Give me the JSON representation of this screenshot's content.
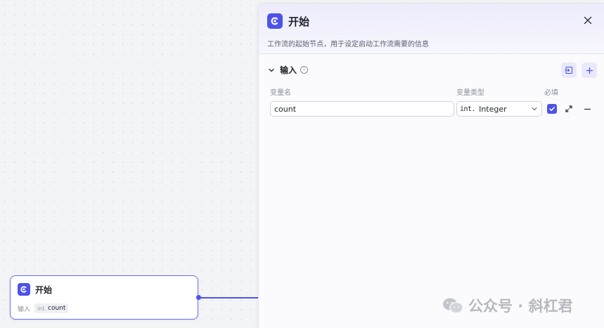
{
  "canvas": {
    "node": {
      "title": "开始",
      "input_label": "输入",
      "param_type": "int.",
      "param_name": "count"
    }
  },
  "panel": {
    "title": "开始",
    "description": "工作流的起始节点，用于设定启动工作流需要的信息",
    "section": {
      "title": "输入",
      "columns": {
        "name": "变量名",
        "type": "变量类型",
        "required": "必填"
      },
      "variables": [
        {
          "name": "count",
          "type_prefix": "int.",
          "type": "Integer",
          "required": true
        }
      ]
    }
  },
  "watermark": {
    "text": "公众号 · 斜杠君"
  },
  "colors": {
    "accent": "#4d53e8",
    "node_border": "#6b6ff0",
    "muted_text": "#8a8f99"
  },
  "icons": {
    "node": "start-node-icon",
    "close": "close-icon",
    "collapse": "chevron-down-icon",
    "info": "info-icon",
    "import": "import-icon",
    "add": "plus-icon",
    "check": "check-icon",
    "expand": "expand-icon",
    "remove": "minus-icon"
  }
}
